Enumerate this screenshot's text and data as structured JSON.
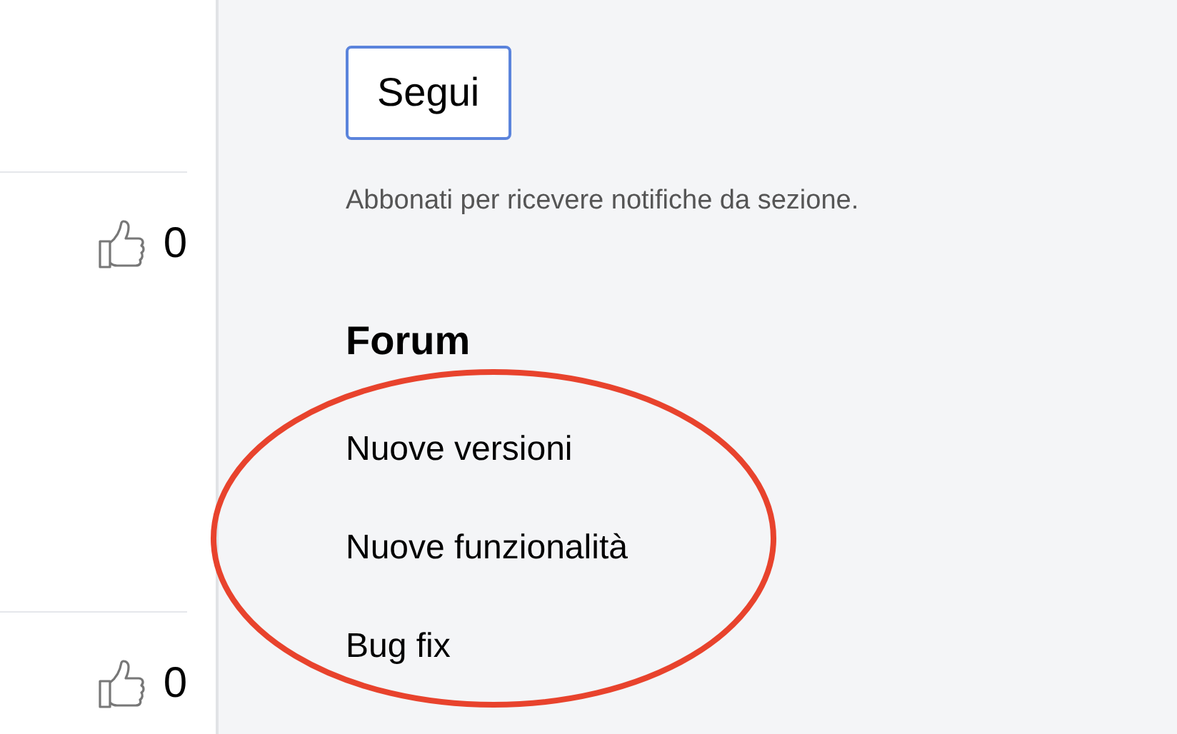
{
  "posts": [
    {
      "likes": "0"
    },
    {
      "likes": "0"
    }
  ],
  "follow_button": "Segui",
  "subscribe_hint": "Abbonati per ricevere notifiche da sezione.",
  "forum": {
    "title": "Forum",
    "links": [
      "Nuove versioni",
      "Nuove funzionalità",
      "Bug fix"
    ]
  }
}
